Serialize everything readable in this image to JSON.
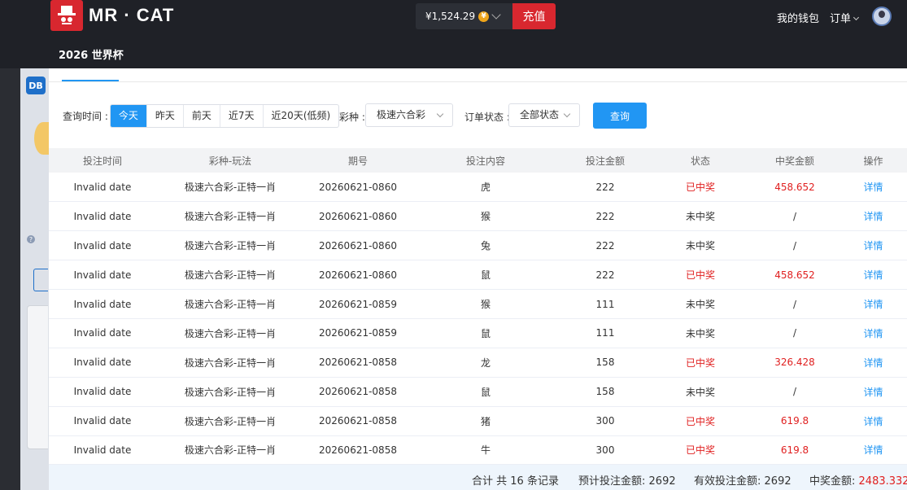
{
  "header": {
    "brand": "MR · CAT",
    "subnav": "2026 世界杯",
    "balance": "¥1,524.29",
    "coin_symbol": "¥",
    "recharge_label": "充值",
    "my_wallet_label": "我的钱包",
    "orders_label": "订单",
    "brand_color": "#d8272f"
  },
  "sidebar": {
    "badge": "DB"
  },
  "filters": {
    "time_label": "查询时间 :",
    "time_options": [
      "今天",
      "昨天",
      "前天",
      "近7天",
      "近20天(低频)"
    ],
    "active_time": "今天",
    "lottery_label": "彩种 :",
    "lottery_value": "极速六合彩",
    "status_label": "订单状态 :",
    "status_value": "全部状态",
    "query_label": "查询"
  },
  "table": {
    "columns": [
      "投注时间",
      "彩种-玩法",
      "期号",
      "投注内容",
      "投注金额",
      "状态",
      "中奖金额",
      "操作"
    ],
    "rows": [
      [
        "Invalid date",
        "极速六合彩-正特一肖",
        "20260621-0860",
        "虎",
        "222",
        "已中奖",
        "458.652",
        "详情"
      ],
      [
        "Invalid date",
        "极速六合彩-正特一肖",
        "20260621-0860",
        "猴",
        "222",
        "未中奖",
        "/",
        "详情"
      ],
      [
        "Invalid date",
        "极速六合彩-正特一肖",
        "20260621-0860",
        "兔",
        "222",
        "未中奖",
        "/",
        "详情"
      ],
      [
        "Invalid date",
        "极速六合彩-正特一肖",
        "20260621-0860",
        "鼠",
        "222",
        "已中奖",
        "458.652",
        "详情"
      ],
      [
        "Invalid date",
        "极速六合彩-正特一肖",
        "20260621-0859",
        "猴",
        "111",
        "未中奖",
        "/",
        "详情"
      ],
      [
        "Invalid date",
        "极速六合彩-正特一肖",
        "20260621-0859",
        "鼠",
        "111",
        "未中奖",
        "/",
        "详情"
      ],
      [
        "Invalid date",
        "极速六合彩-正特一肖",
        "20260621-0858",
        "龙",
        "158",
        "已中奖",
        "326.428",
        "详情"
      ],
      [
        "Invalid date",
        "极速六合彩-正特一肖",
        "20260621-0858",
        "鼠",
        "158",
        "未中奖",
        "/",
        "详情"
      ],
      [
        "Invalid date",
        "极速六合彩-正特一肖",
        "20260621-0858",
        "猪",
        "300",
        "已中奖",
        "619.8",
        "详情"
      ],
      [
        "Invalid date",
        "极速六合彩-正特一肖",
        "20260621-0858",
        "牛",
        "300",
        "已中奖",
        "619.8",
        "详情"
      ]
    ],
    "win_status": "已中奖",
    "win_color": "#e02020",
    "link_color": "#2196f3"
  },
  "summary": {
    "total": "合计 共 16 条记录",
    "expected_label": "预计投注金额:",
    "expected_value": "2692",
    "valid_label": "有效投注金额:",
    "valid_value": "2692",
    "win_label": "中奖金额:",
    "win_value": "2483.332"
  }
}
